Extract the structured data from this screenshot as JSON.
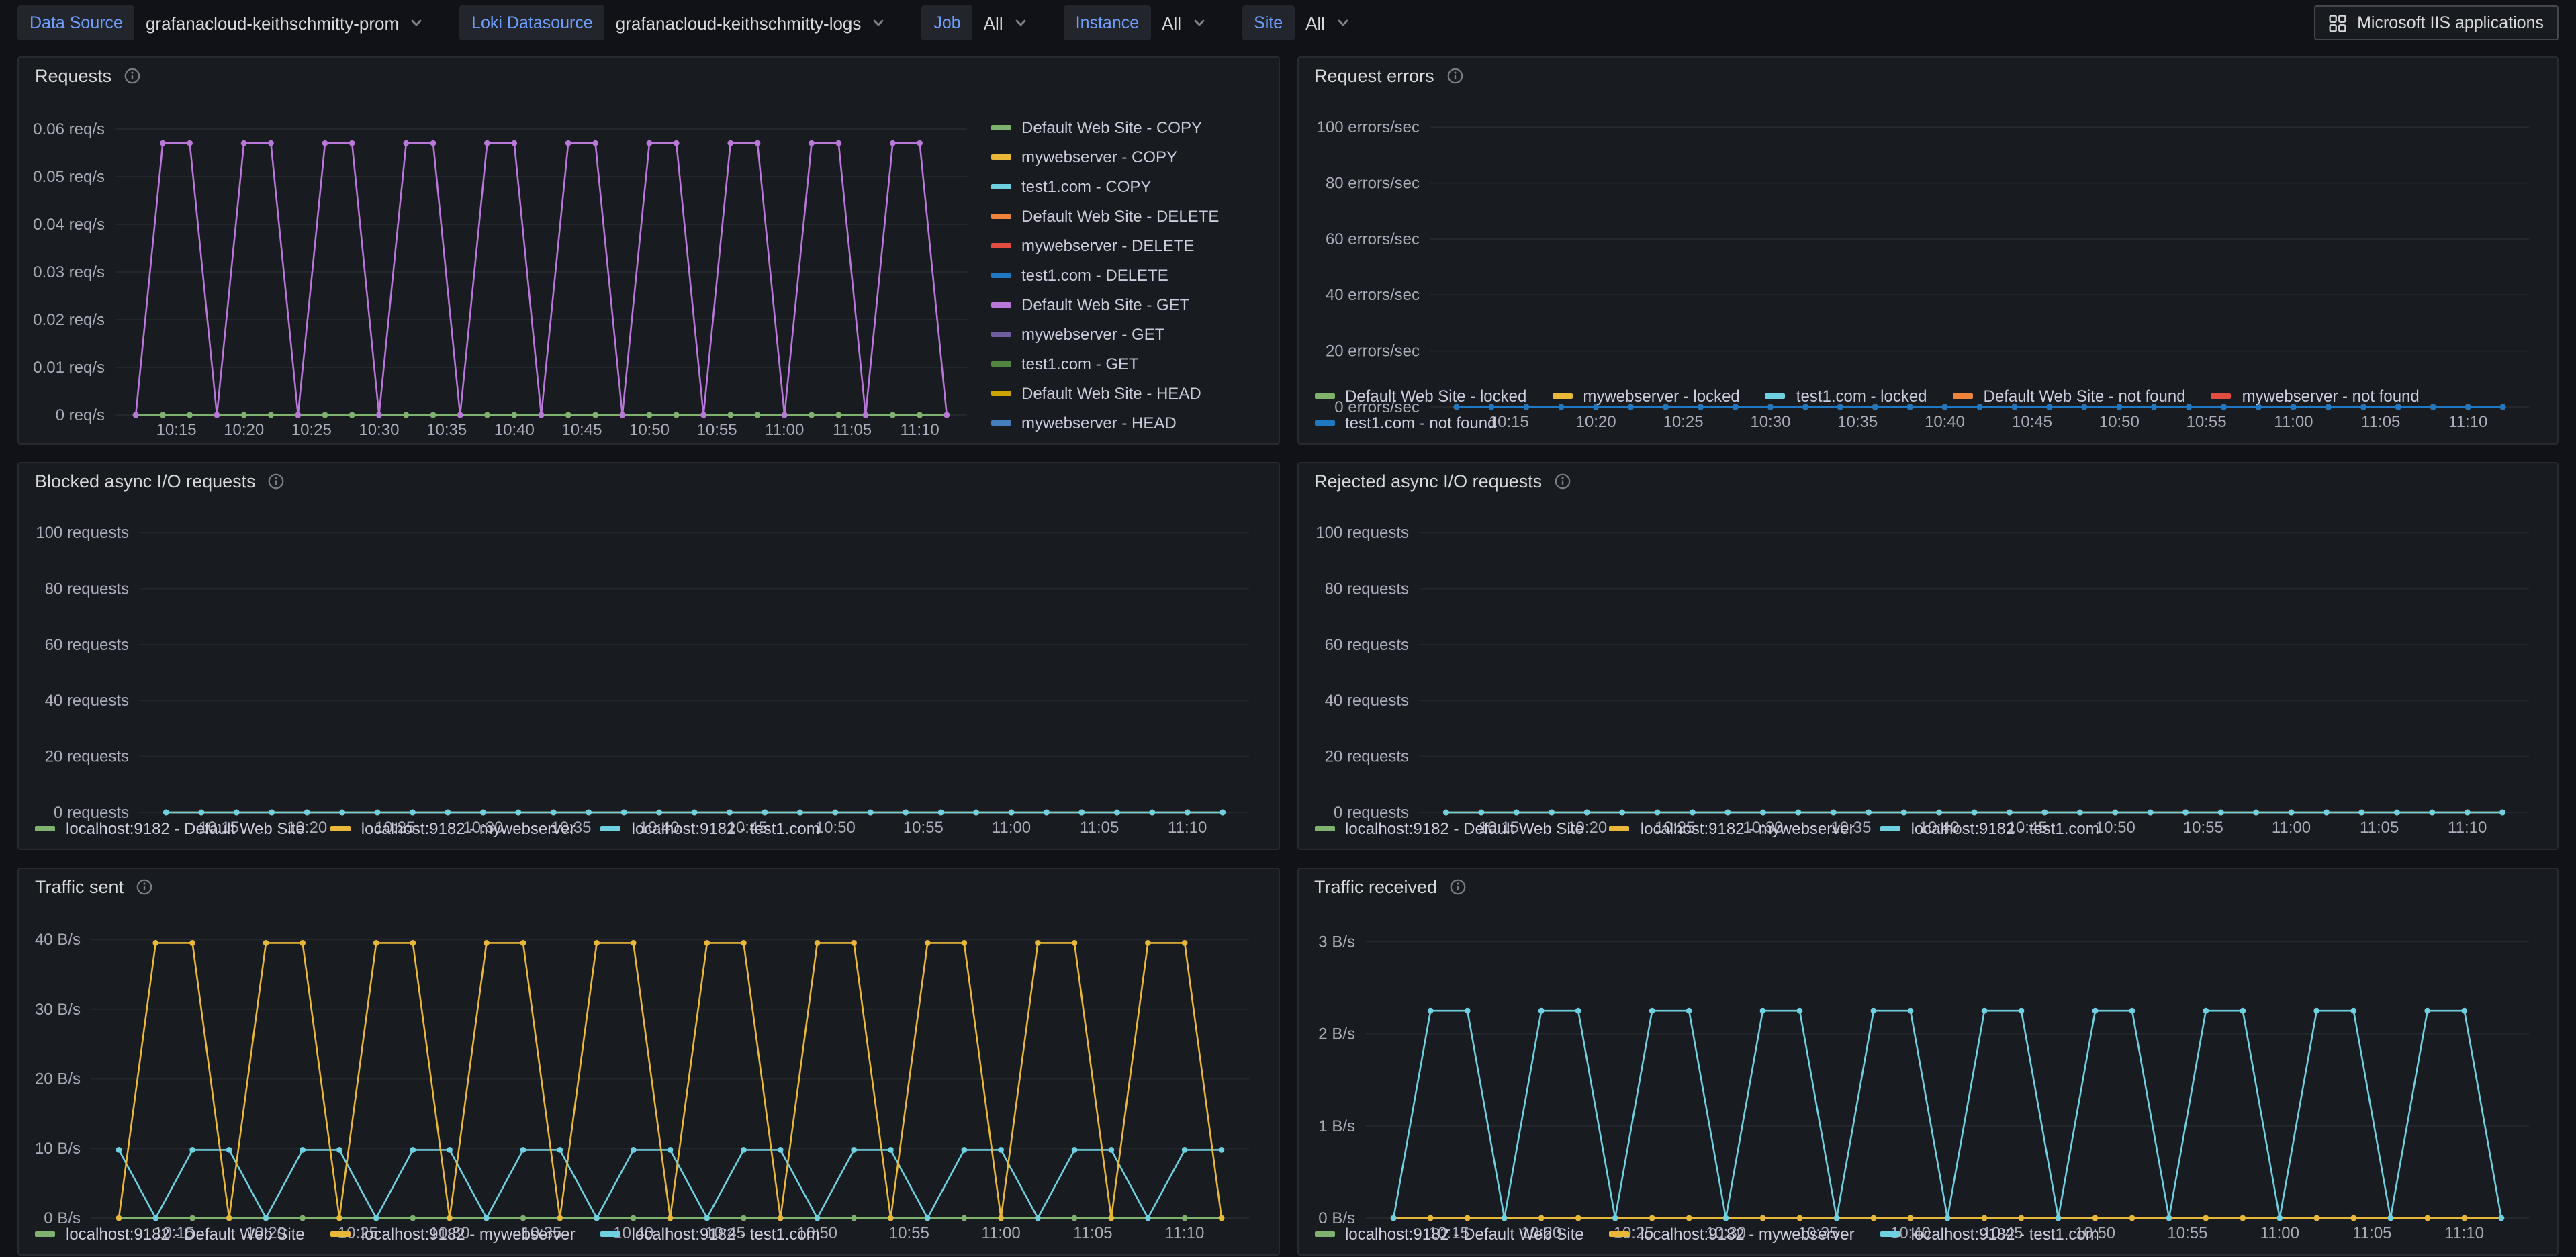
{
  "topbar": {
    "variables": [
      {
        "name": "datasource",
        "label": "Data Source",
        "value": "grafanacloud-keithschmitty-prom"
      },
      {
        "name": "loki-datasource",
        "label": "Loki Datasource",
        "value": "grafanacloud-keithschmitty-logs"
      },
      {
        "name": "job",
        "label": "Job",
        "value": "All"
      },
      {
        "name": "instance",
        "label": "Instance",
        "value": "All"
      },
      {
        "name": "site",
        "label": "Site",
        "value": "All"
      }
    ],
    "app_button_label": "Microsoft IIS applications"
  },
  "time_axis": {
    "x": {
      "start": 612,
      "step": 2,
      "count": 31
    },
    "xlim": [
      610.5,
      673.5
    ],
    "xticks": [
      {
        "v": 615,
        "label": "10:15"
      },
      {
        "v": 620,
        "label": "10:20"
      },
      {
        "v": 625,
        "label": "10:25"
      },
      {
        "v": 630,
        "label": "10:30"
      },
      {
        "v": 635,
        "label": "10:35"
      },
      {
        "v": 640,
        "label": "10:40"
      },
      {
        "v": 645,
        "label": "10:45"
      },
      {
        "v": 650,
        "label": "10:50"
      },
      {
        "v": 655,
        "label": "10:55"
      },
      {
        "v": 660,
        "label": "11:00"
      },
      {
        "v": 665,
        "label": "11:05"
      },
      {
        "v": 670,
        "label": "11:10"
      }
    ]
  },
  "chart_data": [
    {
      "type": "line",
      "title": "Requests",
      "ylabel_unit": "req/s",
      "ylim": [
        0,
        0.0645
      ],
      "axis_width": 62,
      "yticks": [
        {
          "v": 0,
          "label": "0 req/s"
        },
        {
          "v": 0.01,
          "label": "0.01 req/s"
        },
        {
          "v": 0.02,
          "label": "0.02 req/s"
        },
        {
          "v": 0.03,
          "label": "0.03 req/s"
        },
        {
          "v": 0.04,
          "label": "0.04 req/s"
        },
        {
          "v": 0.05,
          "label": "0.05 req/s"
        },
        {
          "v": 0.06,
          "label": "0.06 req/s"
        }
      ],
      "series": [
        {
          "name": "mywebserver - COPY",
          "color": "#EAB839",
          "values": 0
        },
        {
          "name": "test1.com - COPY",
          "color": "#6ED0E0",
          "values": 0
        },
        {
          "name": "Default Web Site - DELETE",
          "color": "#EF843C",
          "values": 0
        },
        {
          "name": "mywebserver - DELETE",
          "color": "#E24D42",
          "values": 0
        },
        {
          "name": "test1.com - DELETE",
          "color": "#1F78C1",
          "values": 0
        },
        {
          "name": "mywebserver - GET",
          "color": "#705DA0",
          "values": 0
        },
        {
          "name": "test1.com - GET",
          "color": "#508642",
          "values": 0
        },
        {
          "name": "Default Web Site - HEAD",
          "color": "#CCA300",
          "values": 0
        },
        {
          "name": "mywebserver - HEAD",
          "color": "#447EBC",
          "values": 0
        },
        {
          "name": "Default Web Site - COPY",
          "color": "#7EB26D",
          "values": 0
        },
        {
          "name": "Default Web Site - GET",
          "color": "#B877D9",
          "values": [
            0,
            0.057,
            0.057,
            0,
            0.057,
            0.057,
            0,
            0.057,
            0.057,
            0,
            0.057,
            0.057,
            0,
            0.057,
            0.057,
            0,
            0.057,
            0.057,
            0,
            0.057,
            0.057,
            0,
            0.057,
            0.057,
            0,
            0.057,
            0.057,
            0,
            0.057,
            0.057,
            0
          ]
        }
      ],
      "legend": {
        "placement": "right",
        "items": [
          {
            "label": "Default Web Site - COPY",
            "color": "#7EB26D"
          },
          {
            "label": "mywebserver - COPY",
            "color": "#EAB839"
          },
          {
            "label": "test1.com - COPY",
            "color": "#6ED0E0"
          },
          {
            "label": "Default Web Site - DELETE",
            "color": "#EF843C"
          },
          {
            "label": "mywebserver - DELETE",
            "color": "#E24D42"
          },
          {
            "label": "test1.com - DELETE",
            "color": "#1F78C1"
          },
          {
            "label": "Default Web Site - GET",
            "color": "#B877D9"
          },
          {
            "label": "mywebserver - GET",
            "color": "#705DA0"
          },
          {
            "label": "test1.com - GET",
            "color": "#508642"
          },
          {
            "label": "Default Web Site - HEAD",
            "color": "#CCA300"
          },
          {
            "label": "mywebserver - HEAD",
            "color": "#447EBC"
          }
        ]
      }
    },
    {
      "type": "line",
      "title": "Request errors",
      "ylabel_unit": "errors/sec",
      "ylim": [
        0,
        107
      ],
      "axis_width": 88,
      "yticks": [
        {
          "v": 0,
          "label": "0 errors/sec"
        },
        {
          "v": 20,
          "label": "20 errors/sec"
        },
        {
          "v": 40,
          "label": "40 errors/sec"
        },
        {
          "v": 60,
          "label": "60 errors/sec"
        },
        {
          "v": 80,
          "label": "80 errors/sec"
        },
        {
          "v": 100,
          "label": "100 errors/sec"
        }
      ],
      "series": [
        {
          "name": "Default Web Site - locked",
          "color": "#7EB26D",
          "values": 0
        },
        {
          "name": "mywebserver - locked",
          "color": "#EAB839",
          "values": 0
        },
        {
          "name": "Default Web Site - not found",
          "color": "#EF843C",
          "values": 0
        },
        {
          "name": "mywebserver - not found",
          "color": "#E24D42",
          "values": 0
        },
        {
          "name": "test1.com - locked",
          "color": "#6ED0E0",
          "values": 0
        },
        {
          "name": "test1.com - not found",
          "color": "#1F78C1",
          "values": 0
        }
      ],
      "legend": {
        "placement": "bottom",
        "items": [
          {
            "label": "Default Web Site - locked",
            "color": "#7EB26D"
          },
          {
            "label": "mywebserver - locked",
            "color": "#EAB839"
          },
          {
            "label": "test1.com - locked",
            "color": "#6ED0E0"
          },
          {
            "label": "Default Web Site - not found",
            "color": "#EF843C"
          },
          {
            "label": "mywebserver - not found",
            "color": "#E24D42"
          },
          {
            "label": "test1.com - not found",
            "color": "#1F78C1"
          }
        ]
      }
    },
    {
      "type": "line",
      "title": "Blocked async I/O requests",
      "ylabel_unit": "requests",
      "ylim": [
        0,
        107
      ],
      "axis_width": 80,
      "yticks": [
        {
          "v": 0,
          "label": "0 requests"
        },
        {
          "v": 20,
          "label": "20 requests"
        },
        {
          "v": 40,
          "label": "40 requests"
        },
        {
          "v": 60,
          "label": "60 requests"
        },
        {
          "v": 80,
          "label": "80 requests"
        },
        {
          "v": 100,
          "label": "100 requests"
        }
      ],
      "series": [
        {
          "name": "localhost:9182 - Default Web Site",
          "color": "#7EB26D",
          "values": 0
        },
        {
          "name": "localhost:9182 - mywebserver",
          "color": "#EAB839",
          "values": 0
        },
        {
          "name": "localhost:9182 - test1.com",
          "color": "#6ED0E0",
          "values": 0
        }
      ],
      "legend": {
        "placement": "bottom",
        "items": [
          {
            "label": "localhost:9182 - Default Web Site",
            "color": "#7EB26D"
          },
          {
            "label": "localhost:9182 - mywebserver",
            "color": "#EAB839"
          },
          {
            "label": "localhost:9182 - test1.com",
            "color": "#6ED0E0"
          }
        ]
      }
    },
    {
      "type": "line",
      "title": "Rejected async I/O requests",
      "ylabel_unit": "requests",
      "ylim": [
        0,
        107
      ],
      "axis_width": 80,
      "yticks": [
        {
          "v": 0,
          "label": "0 requests"
        },
        {
          "v": 20,
          "label": "20 requests"
        },
        {
          "v": 40,
          "label": "40 requests"
        },
        {
          "v": 60,
          "label": "60 requests"
        },
        {
          "v": 80,
          "label": "80 requests"
        },
        {
          "v": 100,
          "label": "100 requests"
        }
      ],
      "series": [
        {
          "name": "localhost:9182 - Default Web Site",
          "color": "#7EB26D",
          "values": 0
        },
        {
          "name": "localhost:9182 - mywebserver",
          "color": "#EAB839",
          "values": 0
        },
        {
          "name": "localhost:9182 - test1.com",
          "color": "#6ED0E0",
          "values": 0
        }
      ],
      "legend": {
        "placement": "bottom",
        "items": [
          {
            "label": "localhost:9182 - Default Web Site",
            "color": "#7EB26D"
          },
          {
            "label": "localhost:9182 - mywebserver",
            "color": "#EAB839"
          },
          {
            "label": "localhost:9182 - test1.com",
            "color": "#6ED0E0"
          }
        ]
      }
    },
    {
      "type": "line",
      "title": "Traffic sent",
      "ylabel_unit": "B/s",
      "ylim": [
        0,
        43
      ],
      "axis_width": 44,
      "yticks": [
        {
          "v": 0,
          "label": "0 B/s"
        },
        {
          "v": 10,
          "label": "10 B/s"
        },
        {
          "v": 20,
          "label": "20 B/s"
        },
        {
          "v": 30,
          "label": "30 B/s"
        },
        {
          "v": 40,
          "label": "40 B/s"
        }
      ],
      "series": [
        {
          "name": "localhost:9182 - Default Web Site",
          "color": "#7EB26D",
          "values": 0
        },
        {
          "name": "localhost:9182 - test1.com",
          "color": "#6ED0E0",
          "values": [
            9.8,
            0,
            9.8,
            9.8,
            0,
            9.8,
            9.8,
            0,
            9.8,
            9.8,
            0,
            9.8,
            9.8,
            0,
            9.8,
            9.8,
            0,
            9.8,
            9.8,
            0,
            9.8,
            9.8,
            0,
            9.8,
            9.8,
            0,
            9.8,
            9.8,
            0,
            9.8,
            9.8
          ]
        },
        {
          "name": "localhost:9182 - mywebserver",
          "color": "#EAB839",
          "values": [
            0,
            39.5,
            39.5,
            0,
            39.5,
            39.5,
            0,
            39.5,
            39.5,
            0,
            39.5,
            39.5,
            0,
            39.5,
            39.5,
            0,
            39.5,
            39.5,
            0,
            39.5,
            39.5,
            0,
            39.5,
            39.5,
            0,
            39.5,
            39.5,
            0,
            39.5,
            39.5,
            0
          ]
        }
      ],
      "legend": {
        "placement": "bottom",
        "items": [
          {
            "label": "localhost:9182 - Default Web Site",
            "color": "#7EB26D"
          },
          {
            "label": "localhost:9182 - mywebserver",
            "color": "#EAB839"
          },
          {
            "label": "localhost:9182 - test1.com",
            "color": "#6ED0E0"
          }
        ]
      }
    },
    {
      "type": "line",
      "title": "Traffic received",
      "ylabel_unit": "B/s",
      "ylim": [
        0,
        3.25
      ],
      "axis_width": 40,
      "yticks": [
        {
          "v": 0,
          "label": "0 B/s"
        },
        {
          "v": 1,
          "label": "1 B/s"
        },
        {
          "v": 2,
          "label": "2 B/s"
        },
        {
          "v": 3,
          "label": "3 B/s"
        }
      ],
      "series": [
        {
          "name": "localhost:9182 - Default Web Site",
          "color": "#7EB26D",
          "values": 0
        },
        {
          "name": "localhost:9182 - mywebserver",
          "color": "#EAB839",
          "values": 0
        },
        {
          "name": "localhost:9182 - test1.com",
          "color": "#6ED0E0",
          "values": [
            0,
            2.25,
            2.25,
            0,
            2.25,
            2.25,
            0,
            2.25,
            2.25,
            0,
            2.25,
            2.25,
            0,
            2.25,
            2.25,
            0,
            2.25,
            2.25,
            0,
            2.25,
            2.25,
            0,
            2.25,
            2.25,
            0,
            2.25,
            2.25,
            0,
            2.25,
            2.25,
            0
          ]
        }
      ],
      "legend": {
        "placement": "bottom",
        "items": [
          {
            "label": "localhost:9182 - Default Web Site",
            "color": "#7EB26D"
          },
          {
            "label": "localhost:9182 - mywebserver",
            "color": "#EAB839"
          },
          {
            "label": "localhost:9182 - test1.com",
            "color": "#6ED0E0"
          }
        ]
      }
    }
  ],
  "colors": {
    "page_bg": "#111217",
    "panel_bg": "#181b1f",
    "label_blue": "#6e9fff",
    "text": "#ccccdc"
  }
}
